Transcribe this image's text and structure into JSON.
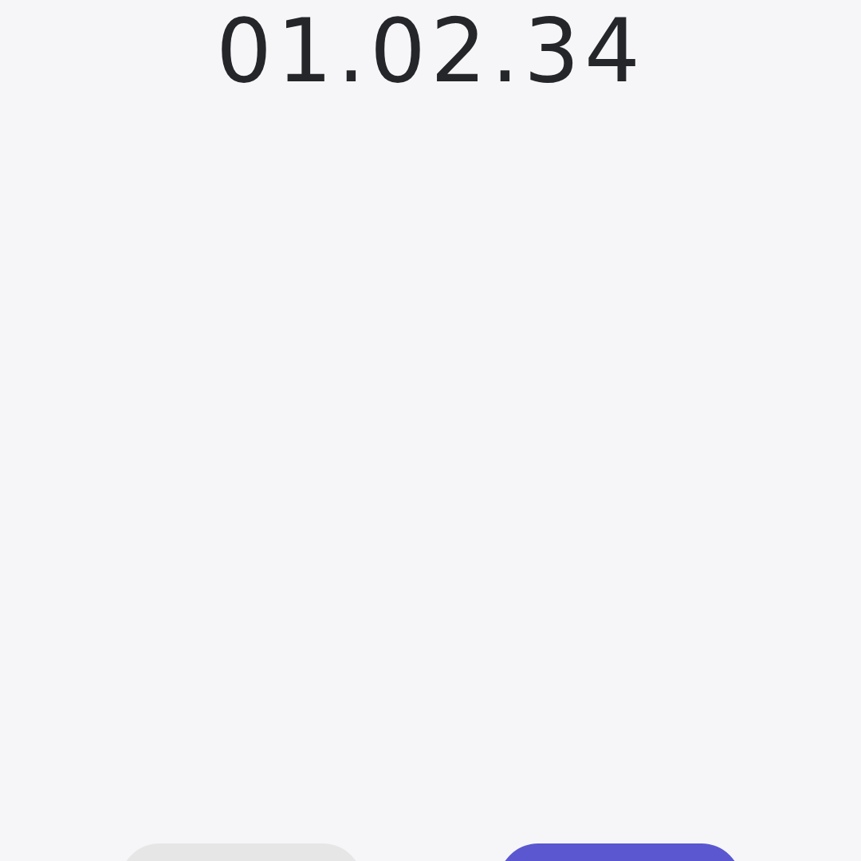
{
  "timer": {
    "time": "01.02.34"
  },
  "buttons": [
    {
      "kind": "secondary"
    },
    {
      "kind": "primary"
    }
  ]
}
